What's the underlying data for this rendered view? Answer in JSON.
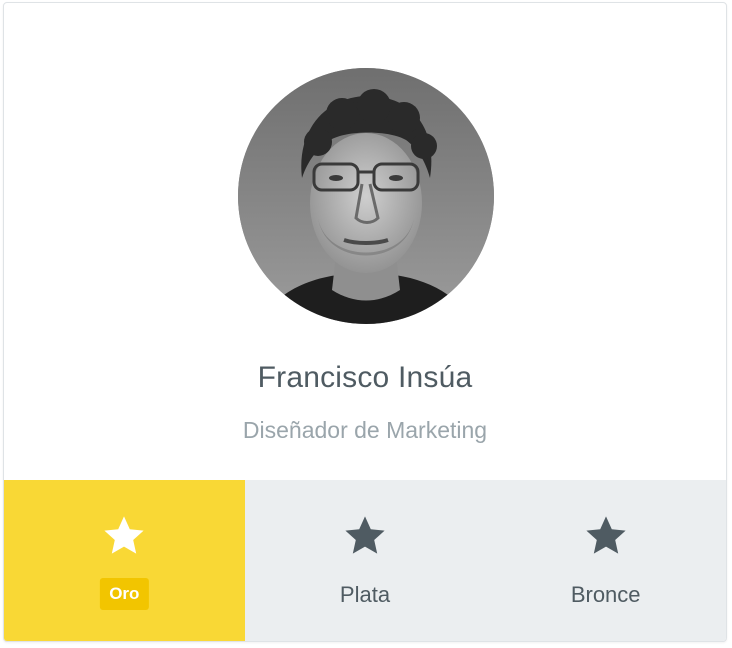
{
  "profile": {
    "name": "Francisco Insúa",
    "role": "Diseñador de Marketing",
    "avatar_alt": "profile-photo"
  },
  "tiers": [
    {
      "label": "Oro",
      "icon": "star-icon",
      "selected": true,
      "color": "#f9d835"
    },
    {
      "label": "Plata",
      "icon": "star-icon",
      "selected": false,
      "color": "#ebeef0"
    },
    {
      "label": "Bronce",
      "icon": "star-icon",
      "selected": false,
      "color": "#ebeef0"
    }
  ],
  "colors": {
    "text_primary": "#4f5b62",
    "text_secondary": "#9aa5ab",
    "accent": "#f9d835",
    "badge": "#f2c500",
    "inactive_bg": "#ebeef0"
  }
}
